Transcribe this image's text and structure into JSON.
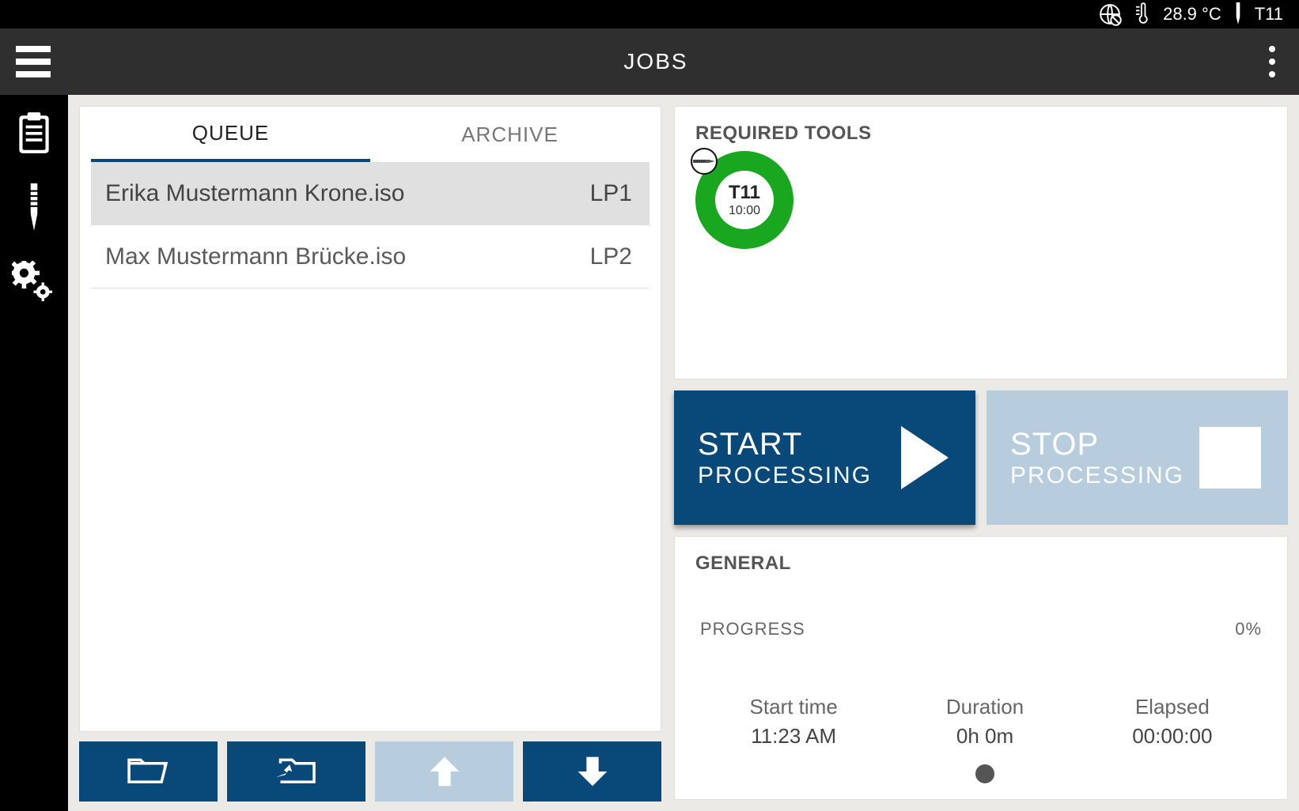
{
  "status_bar": {
    "temperature": "28.9 °C",
    "tool": "T11"
  },
  "header": {
    "title": "JOBS"
  },
  "tabs": {
    "queue": "QUEUE",
    "archive": "ARCHIVE"
  },
  "jobs": [
    {
      "name": "Erika Mustermann Krone.iso",
      "slot": "LP1",
      "selected": true
    },
    {
      "name": "Max Mustermann Brücke.iso",
      "slot": "LP2",
      "selected": false
    }
  ],
  "required_tools": {
    "title": "REQUIRED TOOLS",
    "tool_name": "T11",
    "tool_time": "10:00"
  },
  "actions": {
    "start_title": "START",
    "start_sub": "PROCESSING",
    "stop_title": "STOP",
    "stop_sub": "PROCESSING"
  },
  "general": {
    "title": "GENERAL",
    "progress_label": "PROGRESS",
    "progress_value": "0%",
    "start_time_label": "Start time",
    "start_time_value": "11:23 AM",
    "duration_label": "Duration",
    "duration_value": "0h 0m",
    "elapsed_label": "Elapsed",
    "elapsed_value": "00:00:00"
  }
}
